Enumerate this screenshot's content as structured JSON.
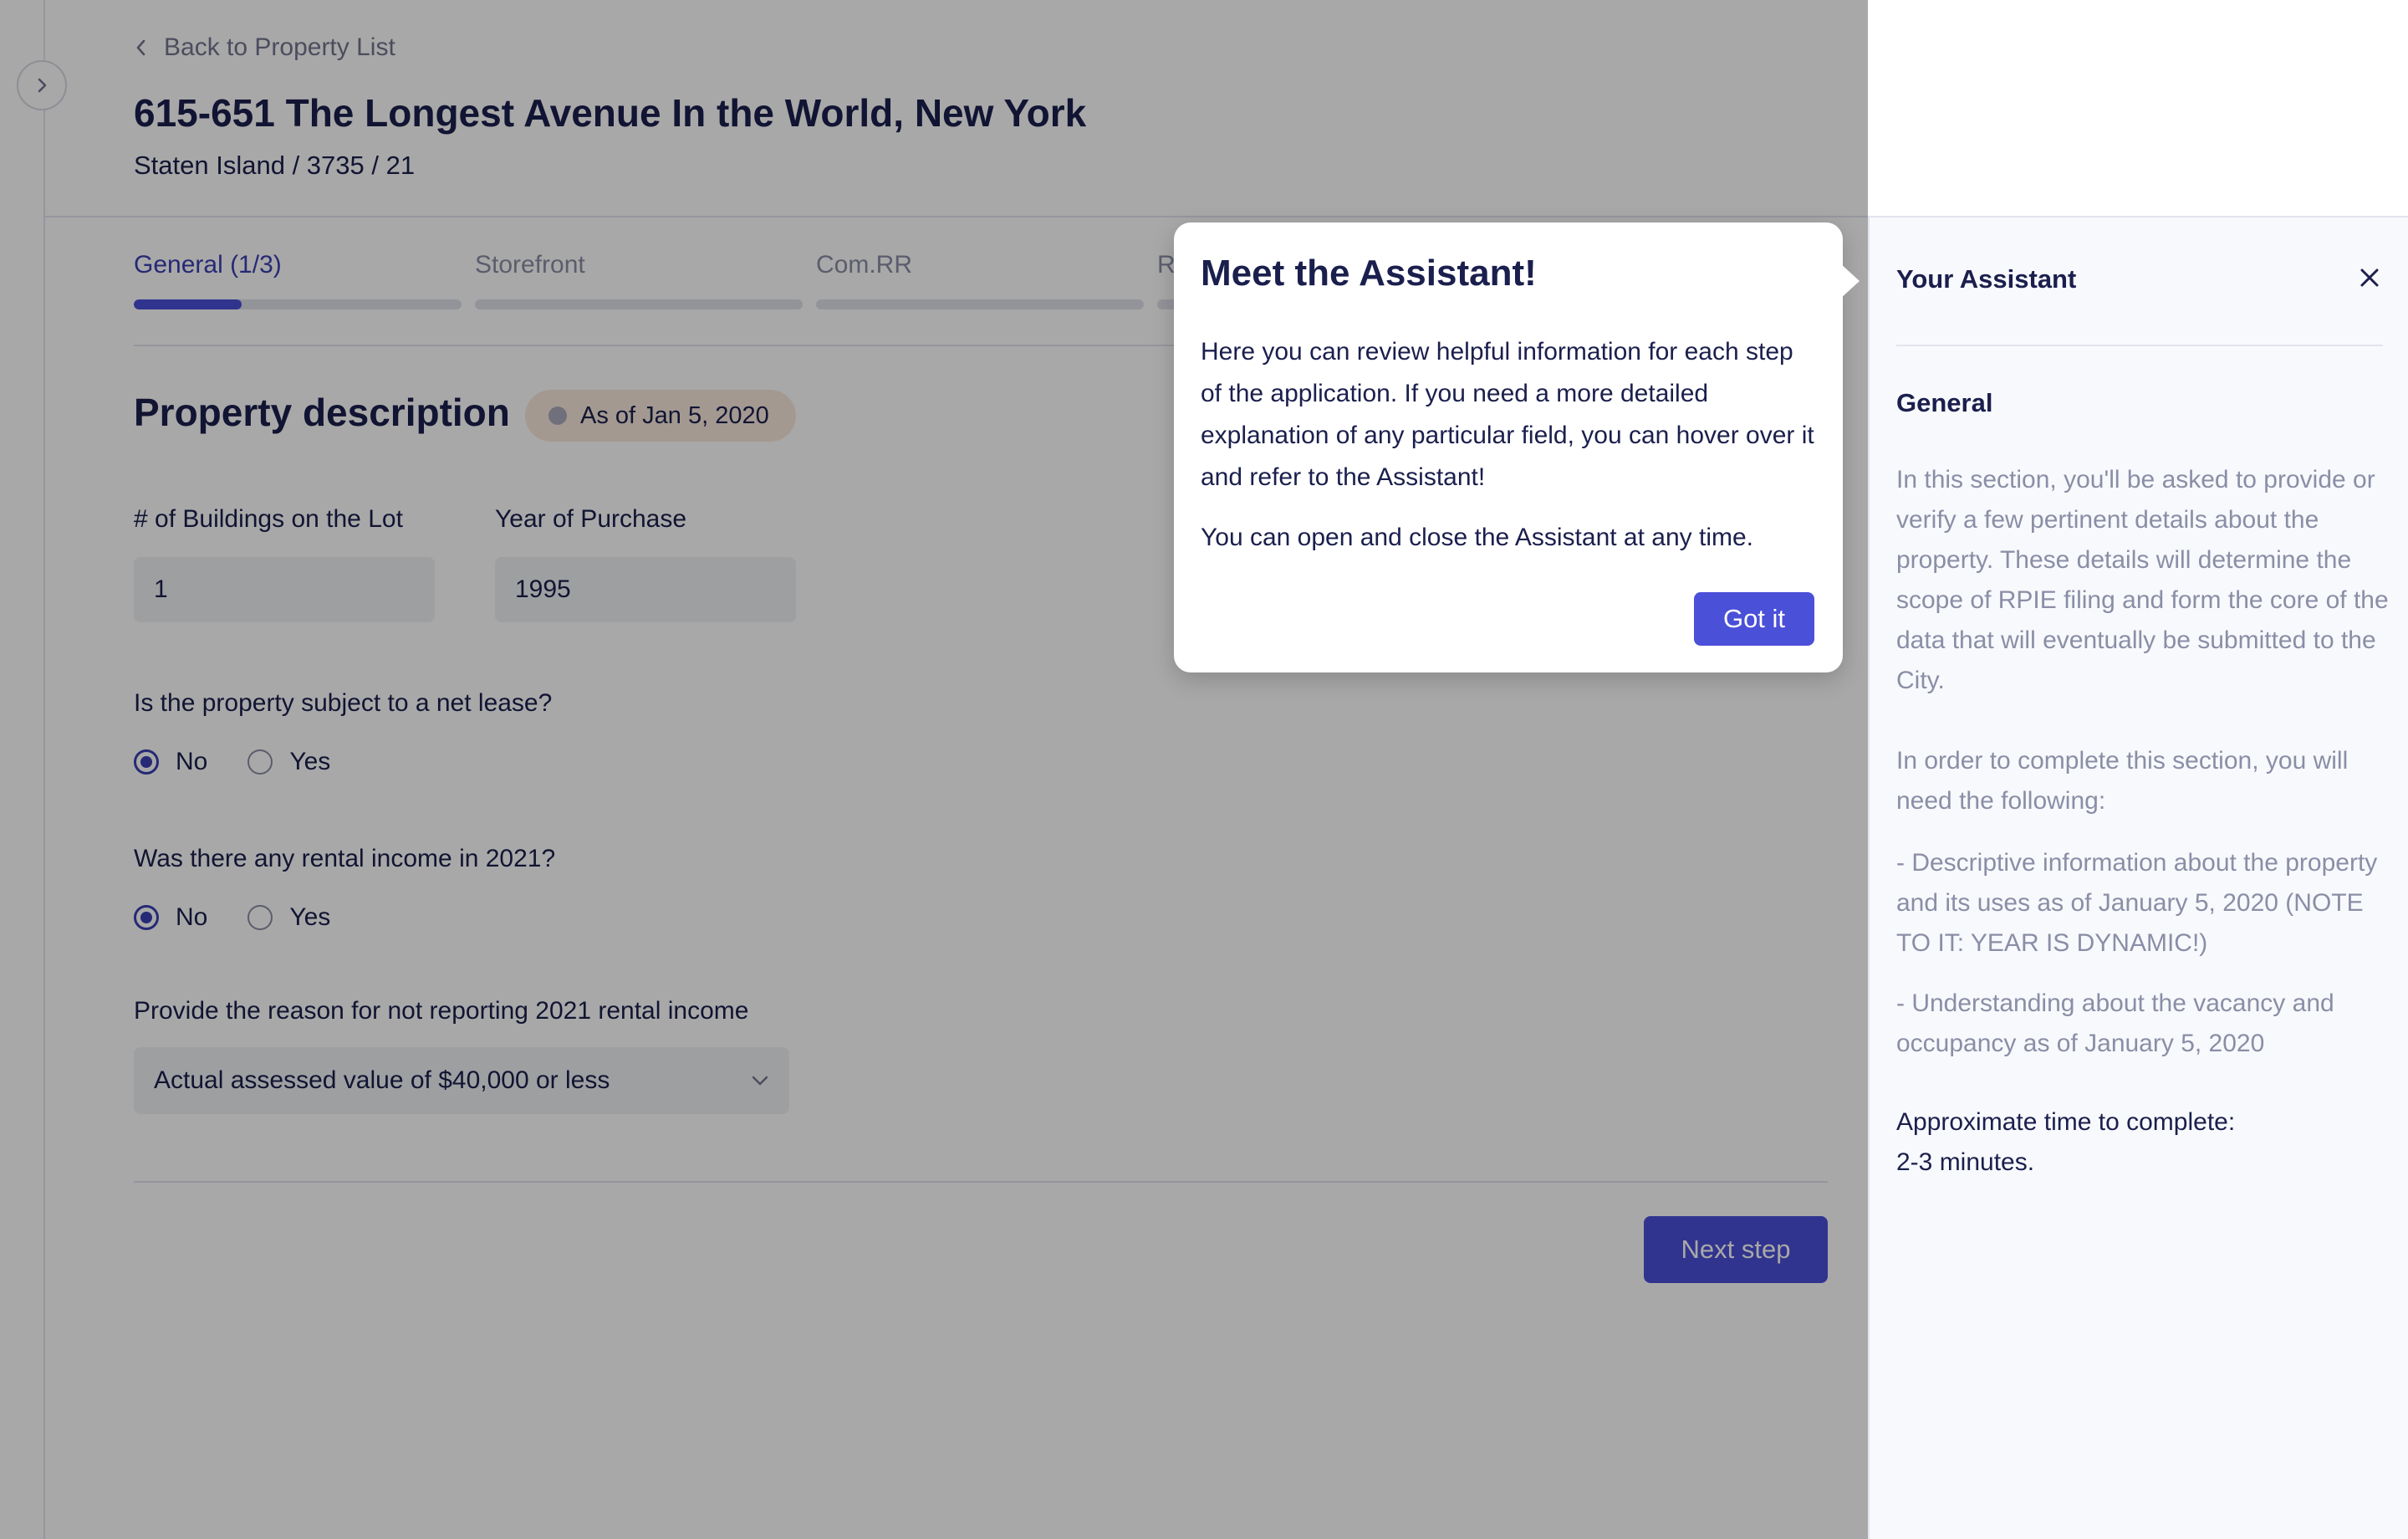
{
  "header": {
    "back_label": "Back to Property List",
    "title": "615-651 The Longest Avenue In the World, New York",
    "subtitle": "Staten Island / 3735 / 21"
  },
  "tabs": [
    {
      "label": "General (1/3)",
      "active": true,
      "progress": 0.33
    },
    {
      "label": "Storefront",
      "active": false,
      "progress": 0
    },
    {
      "label": "Com.RR",
      "active": false,
      "progress": 0
    },
    {
      "label": "R",
      "active": false,
      "progress": 0
    }
  ],
  "form": {
    "section_title": "Property description",
    "date_badge": "As of Jan 5, 2020",
    "buildings_label": "# of Buildings on the Lot",
    "buildings_value": "1",
    "year_label": "Year of Purchase",
    "year_value": "1995",
    "net_lease_question": "Is the property subject to a net lease?",
    "net_lease_options": [
      "No",
      "Yes"
    ],
    "net_lease_selected": "No",
    "rental_question": "Was there any rental income in 2021?",
    "rental_options": [
      "No",
      "Yes"
    ],
    "rental_selected": "No",
    "reason_label": "Provide the reason for not reporting 2021 rental income",
    "reason_value": "Actual assessed value of $40,000 or less",
    "next_label": "Next step"
  },
  "popover": {
    "title": "Meet the Assistant!",
    "body": "Here you can review helpful information for each step of the application. If you need a more detailed explanation of any particular field, you can hover over it and refer to the Assistant!",
    "body2": "You can open and close the Assistant at any time.",
    "button": "Got it"
  },
  "assistant": {
    "title": "Your Assistant",
    "section": "General",
    "p1": "In this section, you'll be asked to provide or verify a few pertinent details about the property. These details will determine the scope of RPIE filing and form the core of the data that will eventually be submitted to the City.",
    "p2": "In order to complete this section, you will need the following:",
    "p3": "- Descriptive information about the property and its uses as of January 5, 2020 (NOTE TO IT: YEAR IS DYNAMIC!)",
    "p4": "- Understanding about the vacancy and occupancy as of January 5, 2020",
    "time_label": "Approximate time to complete:",
    "time_value": "2-3 minutes."
  },
  "colors": {
    "accent": "#4b50d8",
    "text": "#1b1f4d",
    "muted": "#8a8ea6",
    "badge_bg": "#f7e8dd"
  }
}
